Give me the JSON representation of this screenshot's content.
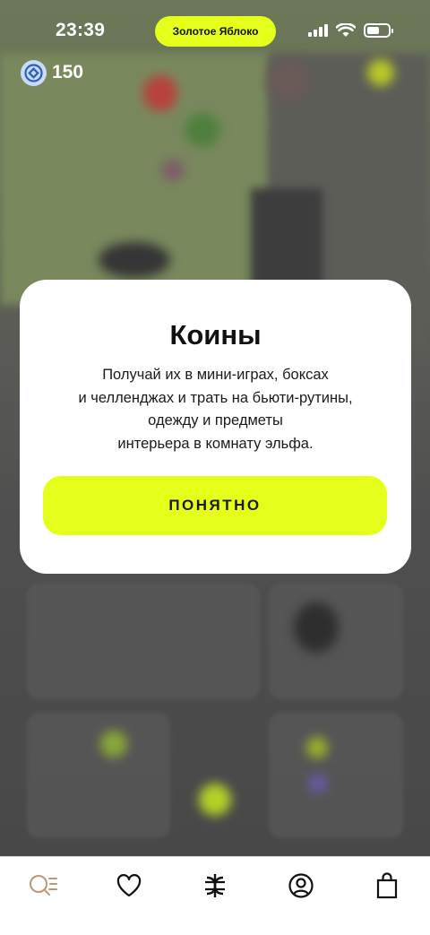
{
  "status_bar": {
    "time": "23:39",
    "island_label": "Золотое Яблоко"
  },
  "coins": {
    "value": "150",
    "icon": "coin-icon"
  },
  "modal": {
    "title": "Коины",
    "body_lines": [
      "Получай их в мини-играх, боксах",
      "и челленджах и трать на бьюти-рутины,",
      "одежду и предметы",
      "интерьера в комнату эльфа."
    ],
    "button_label": "ПОНЯТНО"
  },
  "tab_bar": {
    "items": [
      {
        "icon": "search-icon",
        "active": true
      },
      {
        "icon": "heart-icon",
        "active": false
      },
      {
        "icon": "brand-logo-icon",
        "active": false
      },
      {
        "icon": "profile-icon",
        "active": false
      },
      {
        "icon": "shopping-bag-icon",
        "active": false
      }
    ]
  },
  "colors": {
    "accent": "#e4ff1a",
    "coin": "#c9dcf7",
    "overlay": "#4a4a4a",
    "active_tab": "#b89a7a"
  }
}
